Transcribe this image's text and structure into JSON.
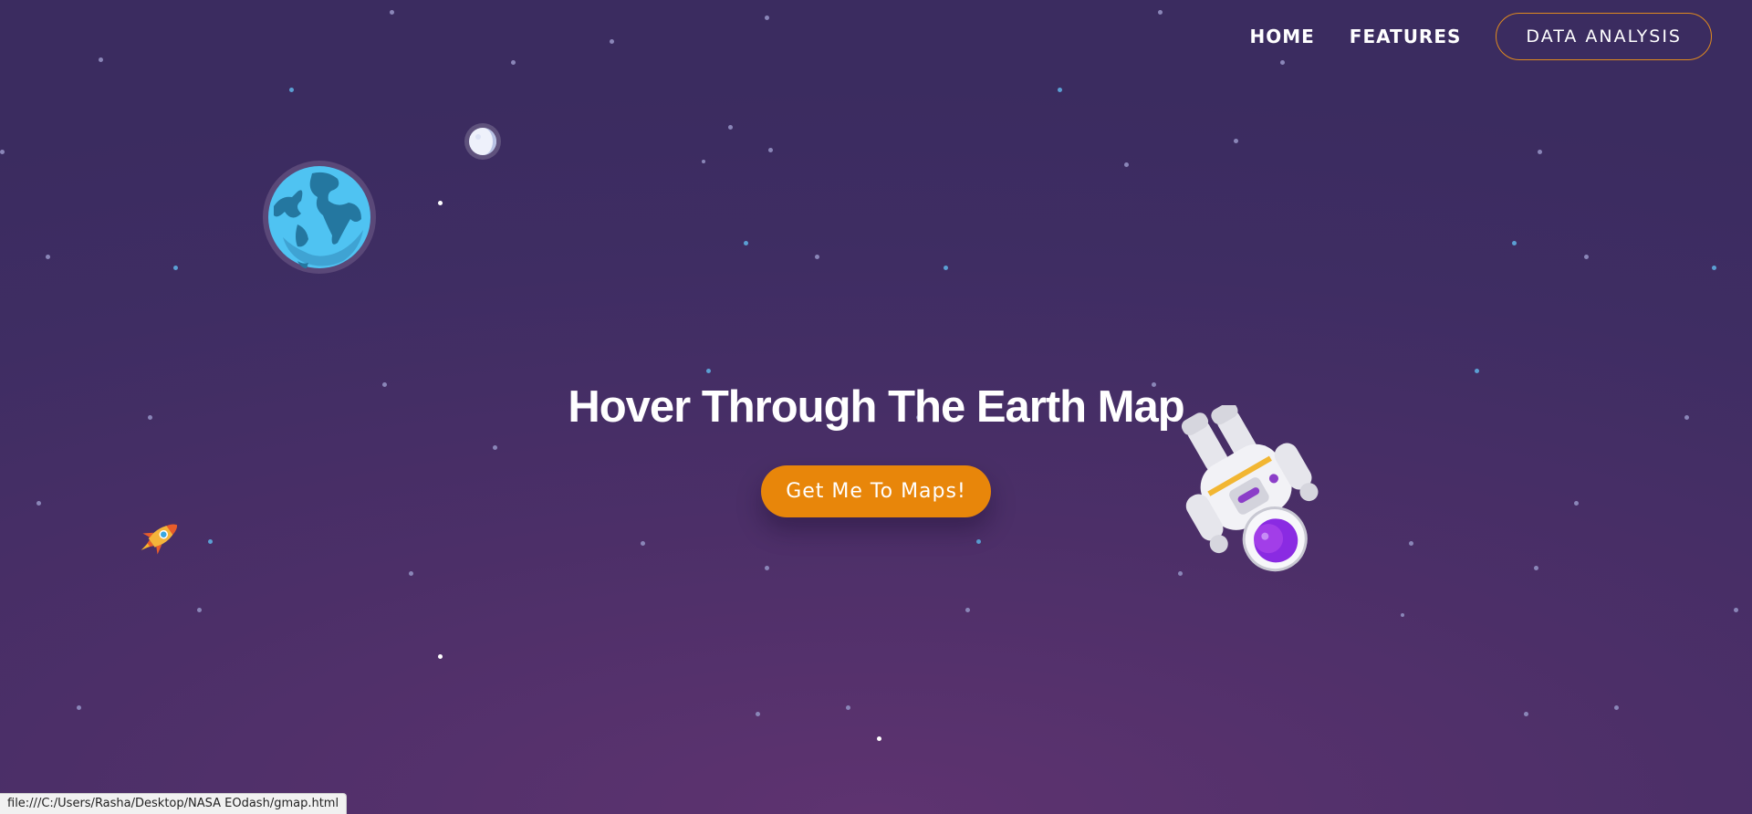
{
  "nav": {
    "home": "HOME",
    "features": "FEATURES",
    "data_analysis": "DATA ANALYSIS",
    "cta_border_color": "#e08a1e"
  },
  "hero": {
    "title": "Hover Through The Earth Map",
    "button": "Get Me To Maps!",
    "button_color": "#e8860a"
  },
  "illustrations": {
    "earth": "earth-planet-icon",
    "moon": "moon-icon",
    "rocket": "rocket-icon",
    "astronaut": "astronaut-icon"
  },
  "status_bar": {
    "url": "file:///C:/Users/Rasha/Desktop/NASA EOdash/gmap.html"
  }
}
